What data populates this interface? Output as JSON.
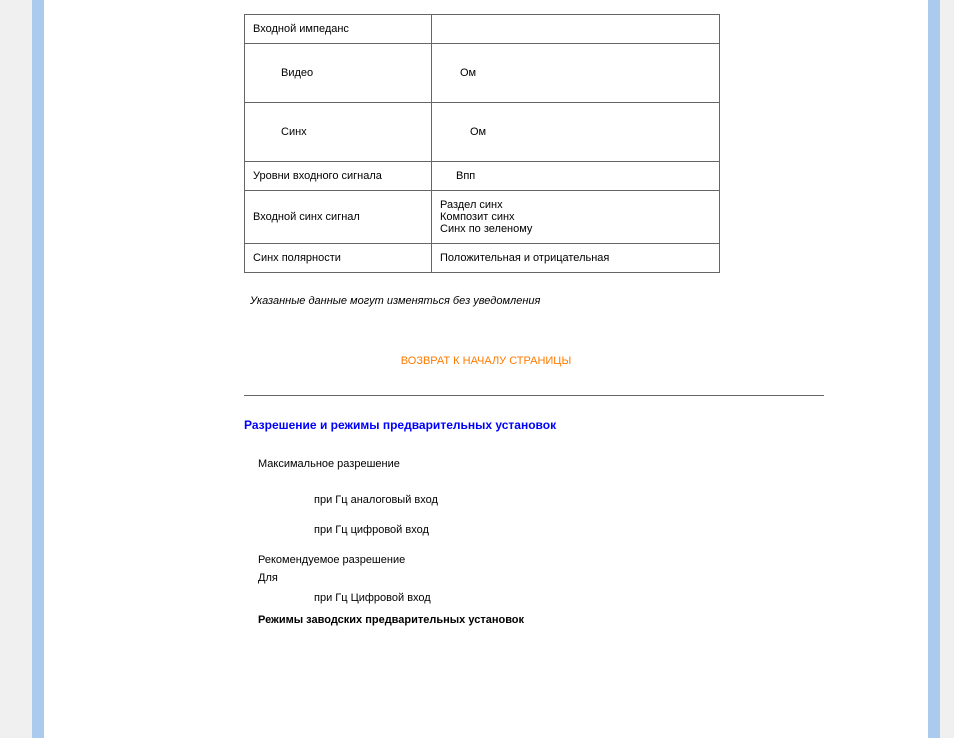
{
  "table": {
    "r1": {
      "label": "Входной импеданс",
      "value": ""
    },
    "r2": {
      "label": "Видео",
      "value": "Ом"
    },
    "r3": {
      "label": "Синх",
      "value": "Ом"
    },
    "r4": {
      "label": "Уровни входного сигнала",
      "value": "Впп"
    },
    "r5": {
      "label": "Входной синх  сигнал",
      "v1": "Раздел  синх",
      "v2": "Композит  синх",
      "v3": "Синх  по зеленому"
    },
    "r6": {
      "label": "Синх  полярности",
      "value": "Положительная и отрицательная"
    }
  },
  "note": "Указанные данные могут изменяться без уведомления",
  "backtop": "ВОЗВРАТ К НАЧАЛУ СТРАНИЦЫ",
  "section_title": "Разрешение и режимы предварительных установок",
  "max_res": "Максимальное разрешение",
  "line_analog": "при      Гц  аналоговый вход",
  "line_digital": "при      Гц  цифровой вход",
  "recommended": "Рекомендуемое разрешение",
  "for": "Для",
  "line_digital_cap": "при      Гц  Цифровой вход",
  "modes": "Режимы заводских предварительных установок"
}
